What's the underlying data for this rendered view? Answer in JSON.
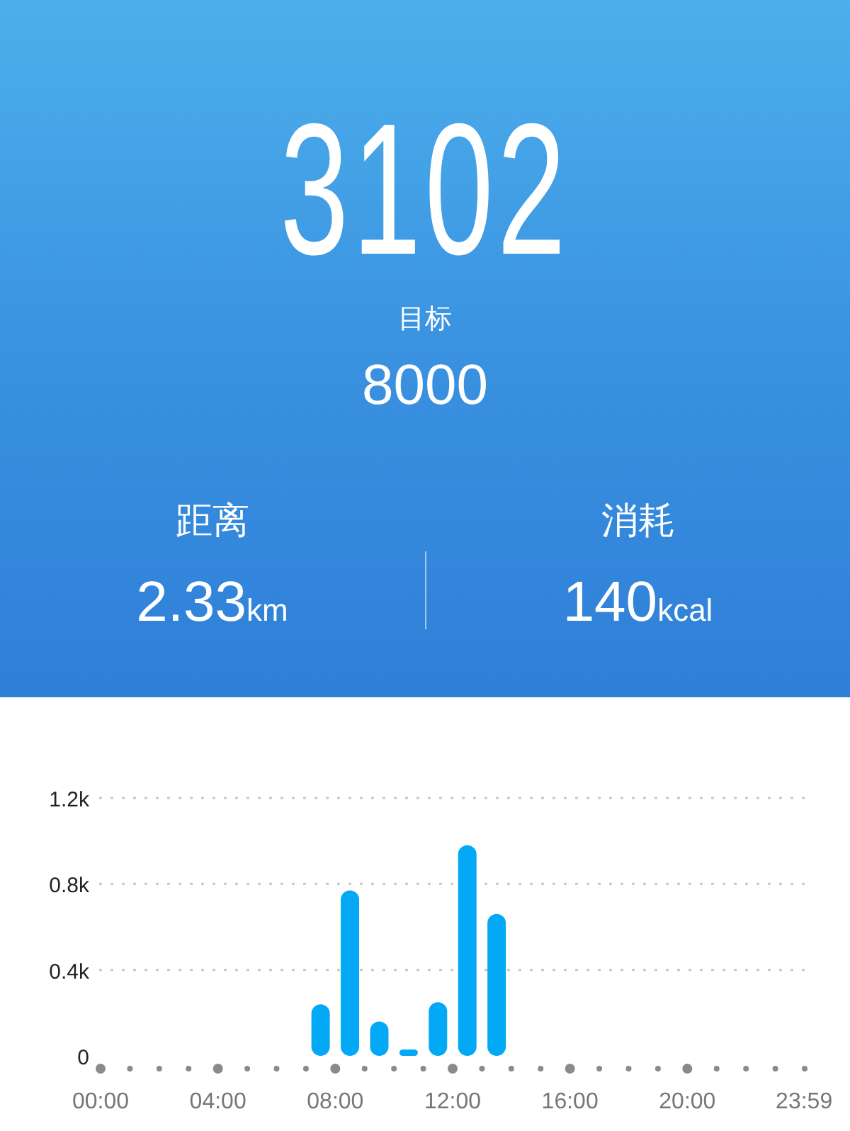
{
  "summary": {
    "steps": "3102",
    "goal_label": "目标",
    "goal": "8000"
  },
  "stats": [
    {
      "label": "距离",
      "value": "2.33",
      "unit": "km"
    },
    {
      "label": "消耗",
      "value": "140",
      "unit": "kcal"
    }
  ],
  "activity": {
    "chart_data": {
      "type": "bar",
      "x": [
        7.5,
        8.5,
        9.5,
        10.5,
        11.5,
        12.5,
        13.5
      ],
      "values": [
        240,
        770,
        160,
        30,
        250,
        980,
        660
      ],
      "xlim": [
        0,
        24
      ],
      "ylim": [
        0,
        1200
      ],
      "yticks": [
        {
          "value": 0,
          "label": "0"
        },
        {
          "value": 400,
          "label": "0.4k"
        },
        {
          "value": 800,
          "label": "0.8k"
        },
        {
          "value": 1200,
          "label": "1.2k"
        }
      ],
      "xticks": [
        {
          "value": 0,
          "label": "00:00"
        },
        {
          "value": 4,
          "label": "04:00"
        },
        {
          "value": 8,
          "label": "08:00"
        },
        {
          "value": 12,
          "label": "12:00"
        },
        {
          "value": 16,
          "label": "16:00"
        },
        {
          "value": 20,
          "label": "20:00"
        },
        {
          "value": 23.98,
          "label": "23:59"
        }
      ]
    }
  }
}
